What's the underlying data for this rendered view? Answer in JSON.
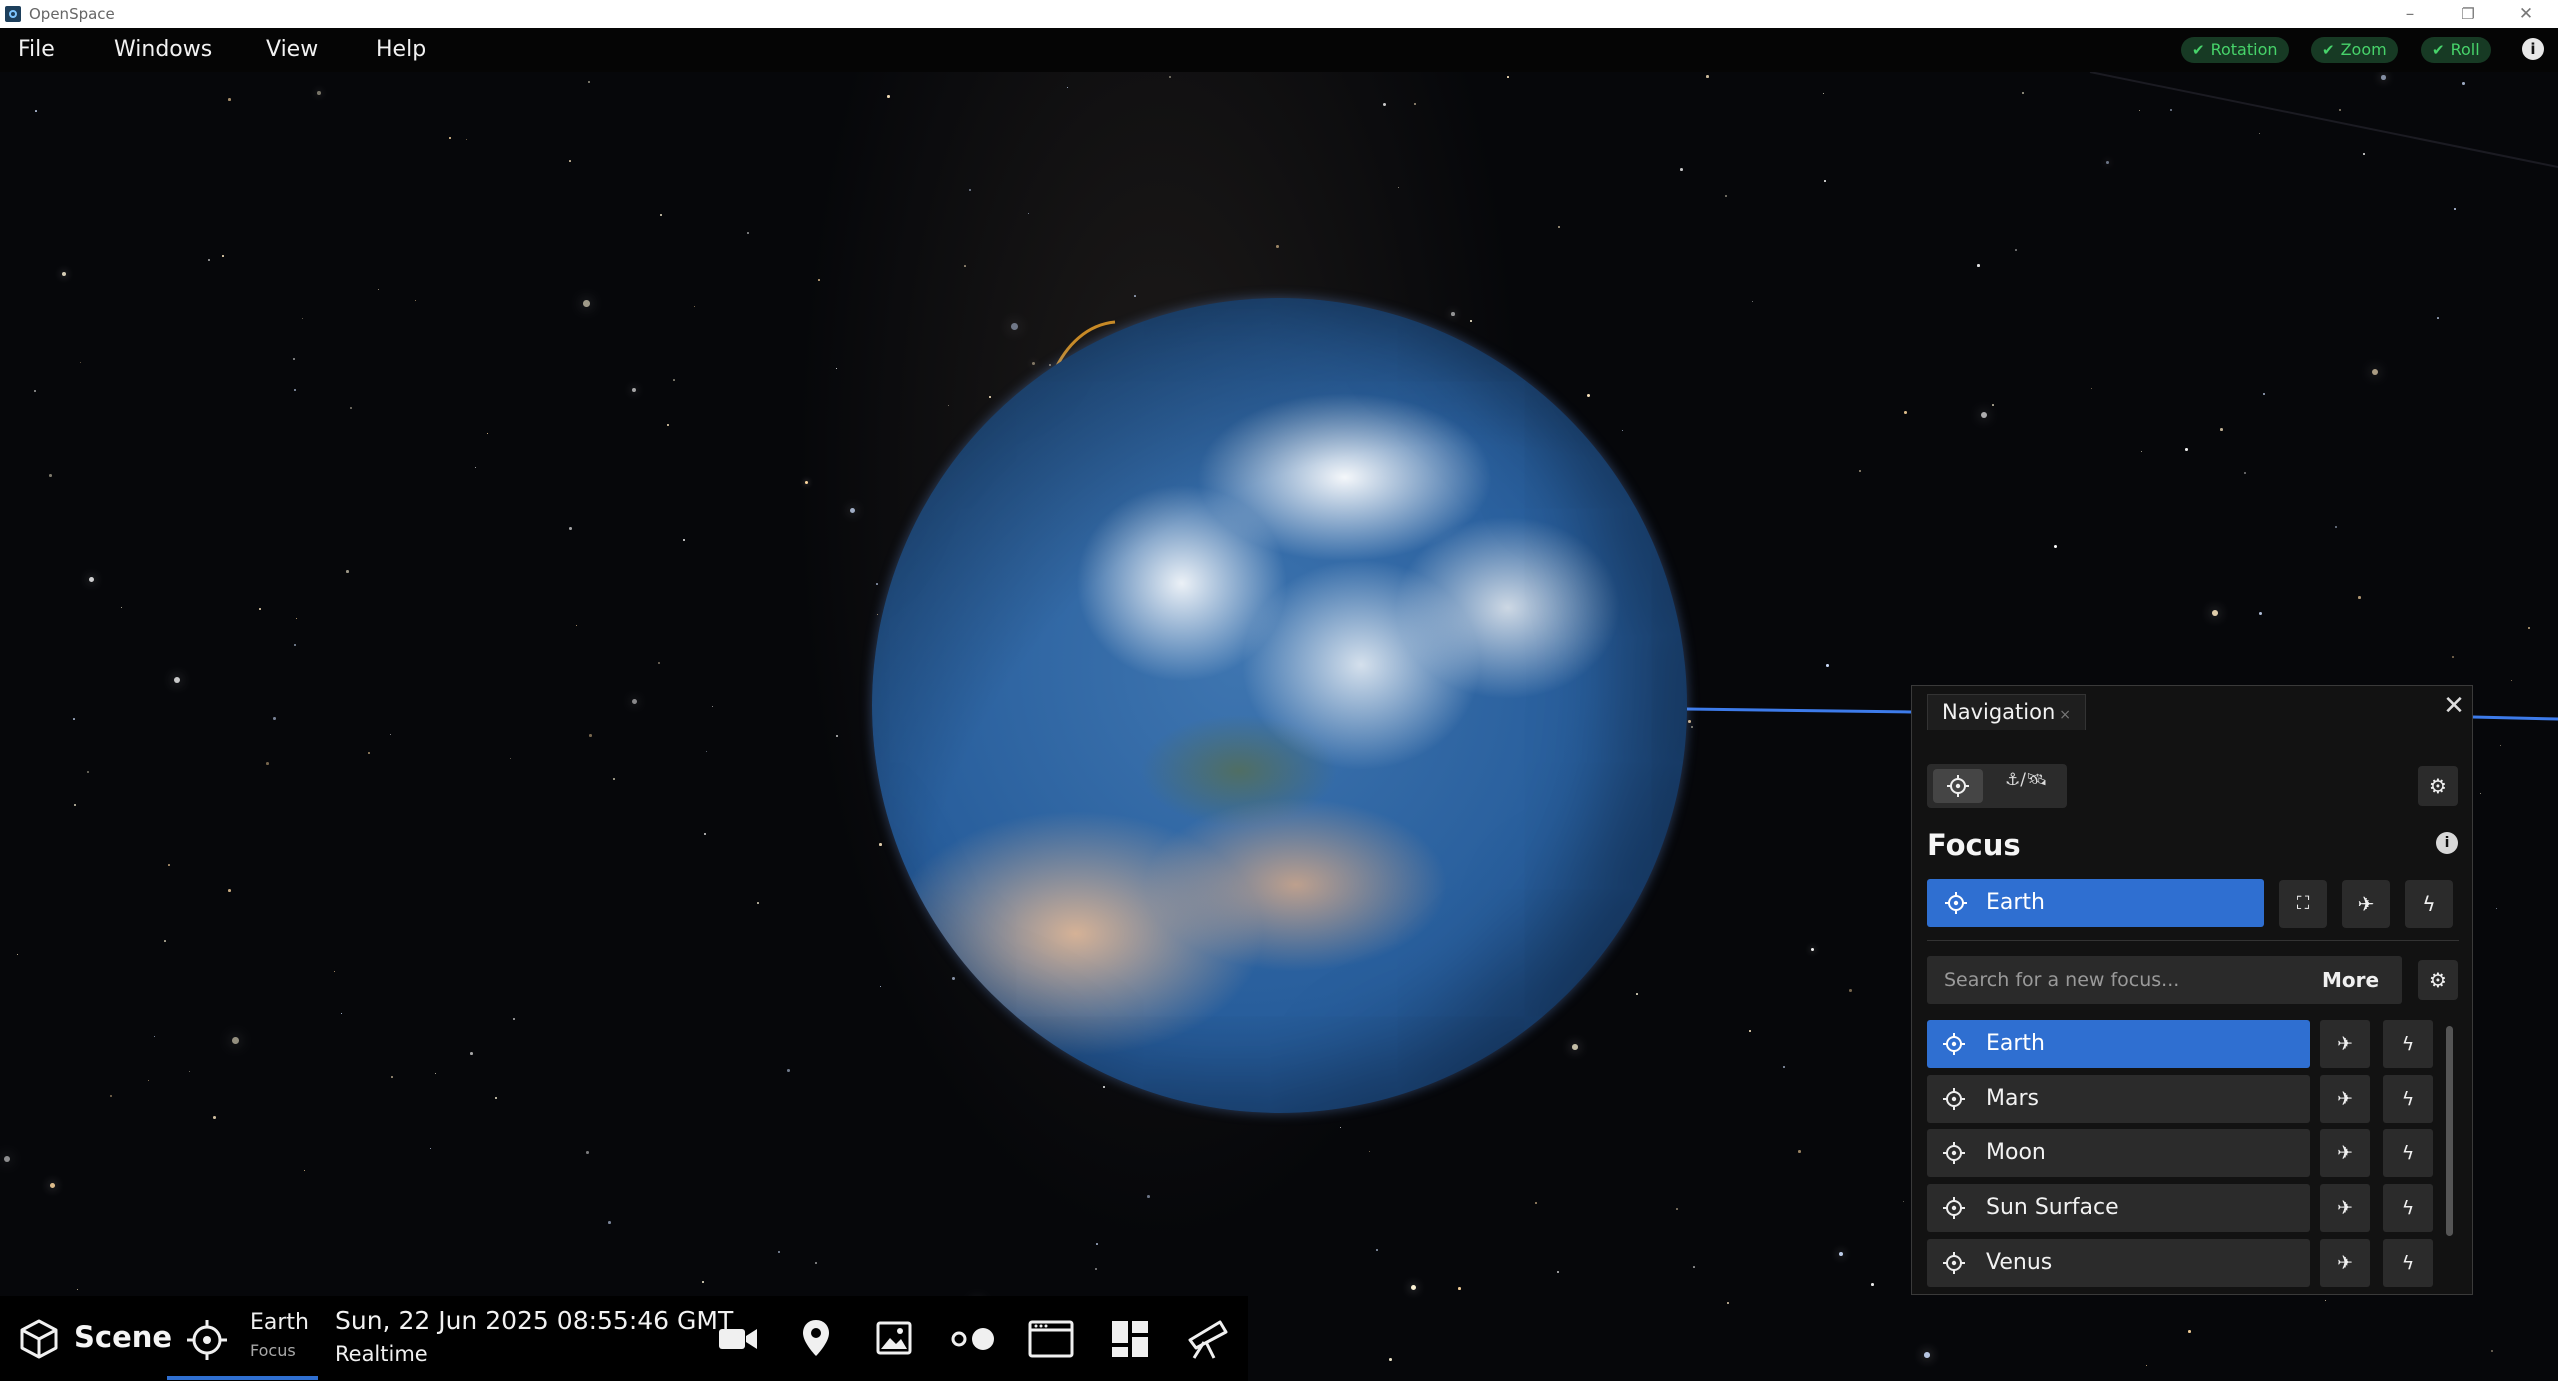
{
  "window": {
    "title": "OpenSpace",
    "minimize_glyph": "–",
    "restore_glyph": "❐",
    "close_glyph": "✕"
  },
  "menubar": {
    "items": [
      "File",
      "Windows",
      "View",
      "Help"
    ],
    "toggles": [
      {
        "label": "Rotation",
        "checked": true
      },
      {
        "label": "Zoom",
        "checked": true
      },
      {
        "label": "Roll",
        "checked": true
      }
    ],
    "info_glyph": "i",
    "accent_color": "#47d36a"
  },
  "navigation": {
    "tab_title": "Navigation",
    "tab_close_glyph": "×",
    "close_glyph": "✕",
    "mode_anchor_label": "⚓/🛰",
    "focus_heading": "Focus",
    "info_glyph": "i",
    "current_focus": "Earth",
    "search_placeholder": "Search for a new focus...",
    "more_label": "More",
    "list": [
      {
        "label": "Earth",
        "active": true
      },
      {
        "label": "Mars",
        "active": false
      },
      {
        "label": "Moon",
        "active": false
      },
      {
        "label": "Sun Surface",
        "active": false
      },
      {
        "label": "Venus",
        "active": false
      }
    ],
    "accent_color": "#2f6fd1",
    "icons": {
      "focus": "target-icon",
      "center": "center-view-icon",
      "fly_to": "airplane-icon",
      "jump": "lightning-icon",
      "settings": "gear-icon"
    }
  },
  "bottombar": {
    "scene_label": "Scene",
    "focus_name": "Earth",
    "focus_sub": "Focus",
    "datetime": "Sun, 22 Jun 2025 08:55:46 GMT",
    "time_mode": "Realtime",
    "icons": [
      "cube-icon",
      "target-icon",
      "video-camera-icon",
      "map-pin-icon",
      "image-icon",
      "flight-path-icon",
      "browser-window-icon",
      "dashboard-icon",
      "telescope-icon"
    ]
  },
  "scene": {
    "planet": "Earth"
  }
}
